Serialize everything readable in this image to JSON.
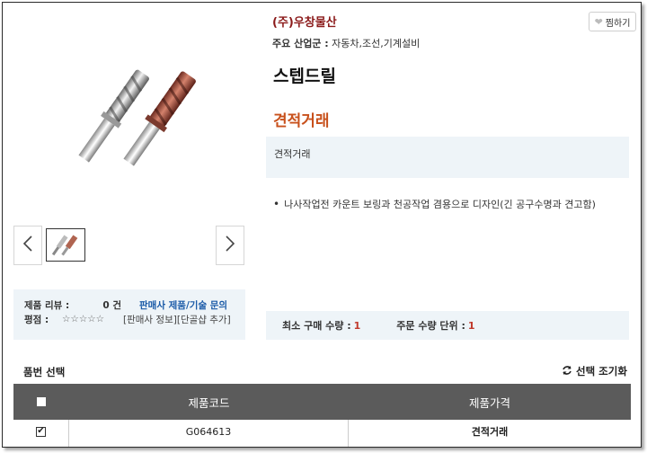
{
  "company": {
    "name": "(주)우창물산"
  },
  "industry": {
    "label": "주요 산업군 :",
    "value": "자동차,조선,기계설비"
  },
  "product": {
    "title": "스텝드릴",
    "price": "견적거래",
    "price_note": "견적거래",
    "description": "나사작업전 카운트 보링과 천공작업 겸용으로 디자인(긴 공구수명과 견고함)"
  },
  "hide_button": {
    "label": "찜하기",
    "icon": "heart-icon"
  },
  "gallery": {
    "prev_icon": "chevron-left-icon",
    "next_icon": "chevron-right-icon"
  },
  "review": {
    "label": "제품 리뷰 :",
    "count": "0 건",
    "inquiry_link": "판매사 제품/기술 문의",
    "rating_label": "평점 :",
    "stars": "☆☆☆☆☆",
    "seller_info": "[판매사 정보]",
    "add_favorite": "[단골샵 추가]"
  },
  "quantity": {
    "min_label": "최소 구매 수량 :",
    "min_value": "1",
    "unit_label": "주문 수량 단위 :",
    "unit_value": "1"
  },
  "options": {
    "title": "품번 선택",
    "reset_label": "선택 조기화",
    "reset_icon": "refresh-icon",
    "columns": [
      "제품코드",
      "제품가격"
    ],
    "rows": [
      {
        "checked": true,
        "code": "G064613",
        "price": "견적거래"
      }
    ]
  },
  "colors": {
    "company": "#8b1a1a",
    "price": "#c8511c",
    "panel_bg": "#eef4f8",
    "table_header": "#5b5b5b",
    "link": "#1b5ba8"
  }
}
